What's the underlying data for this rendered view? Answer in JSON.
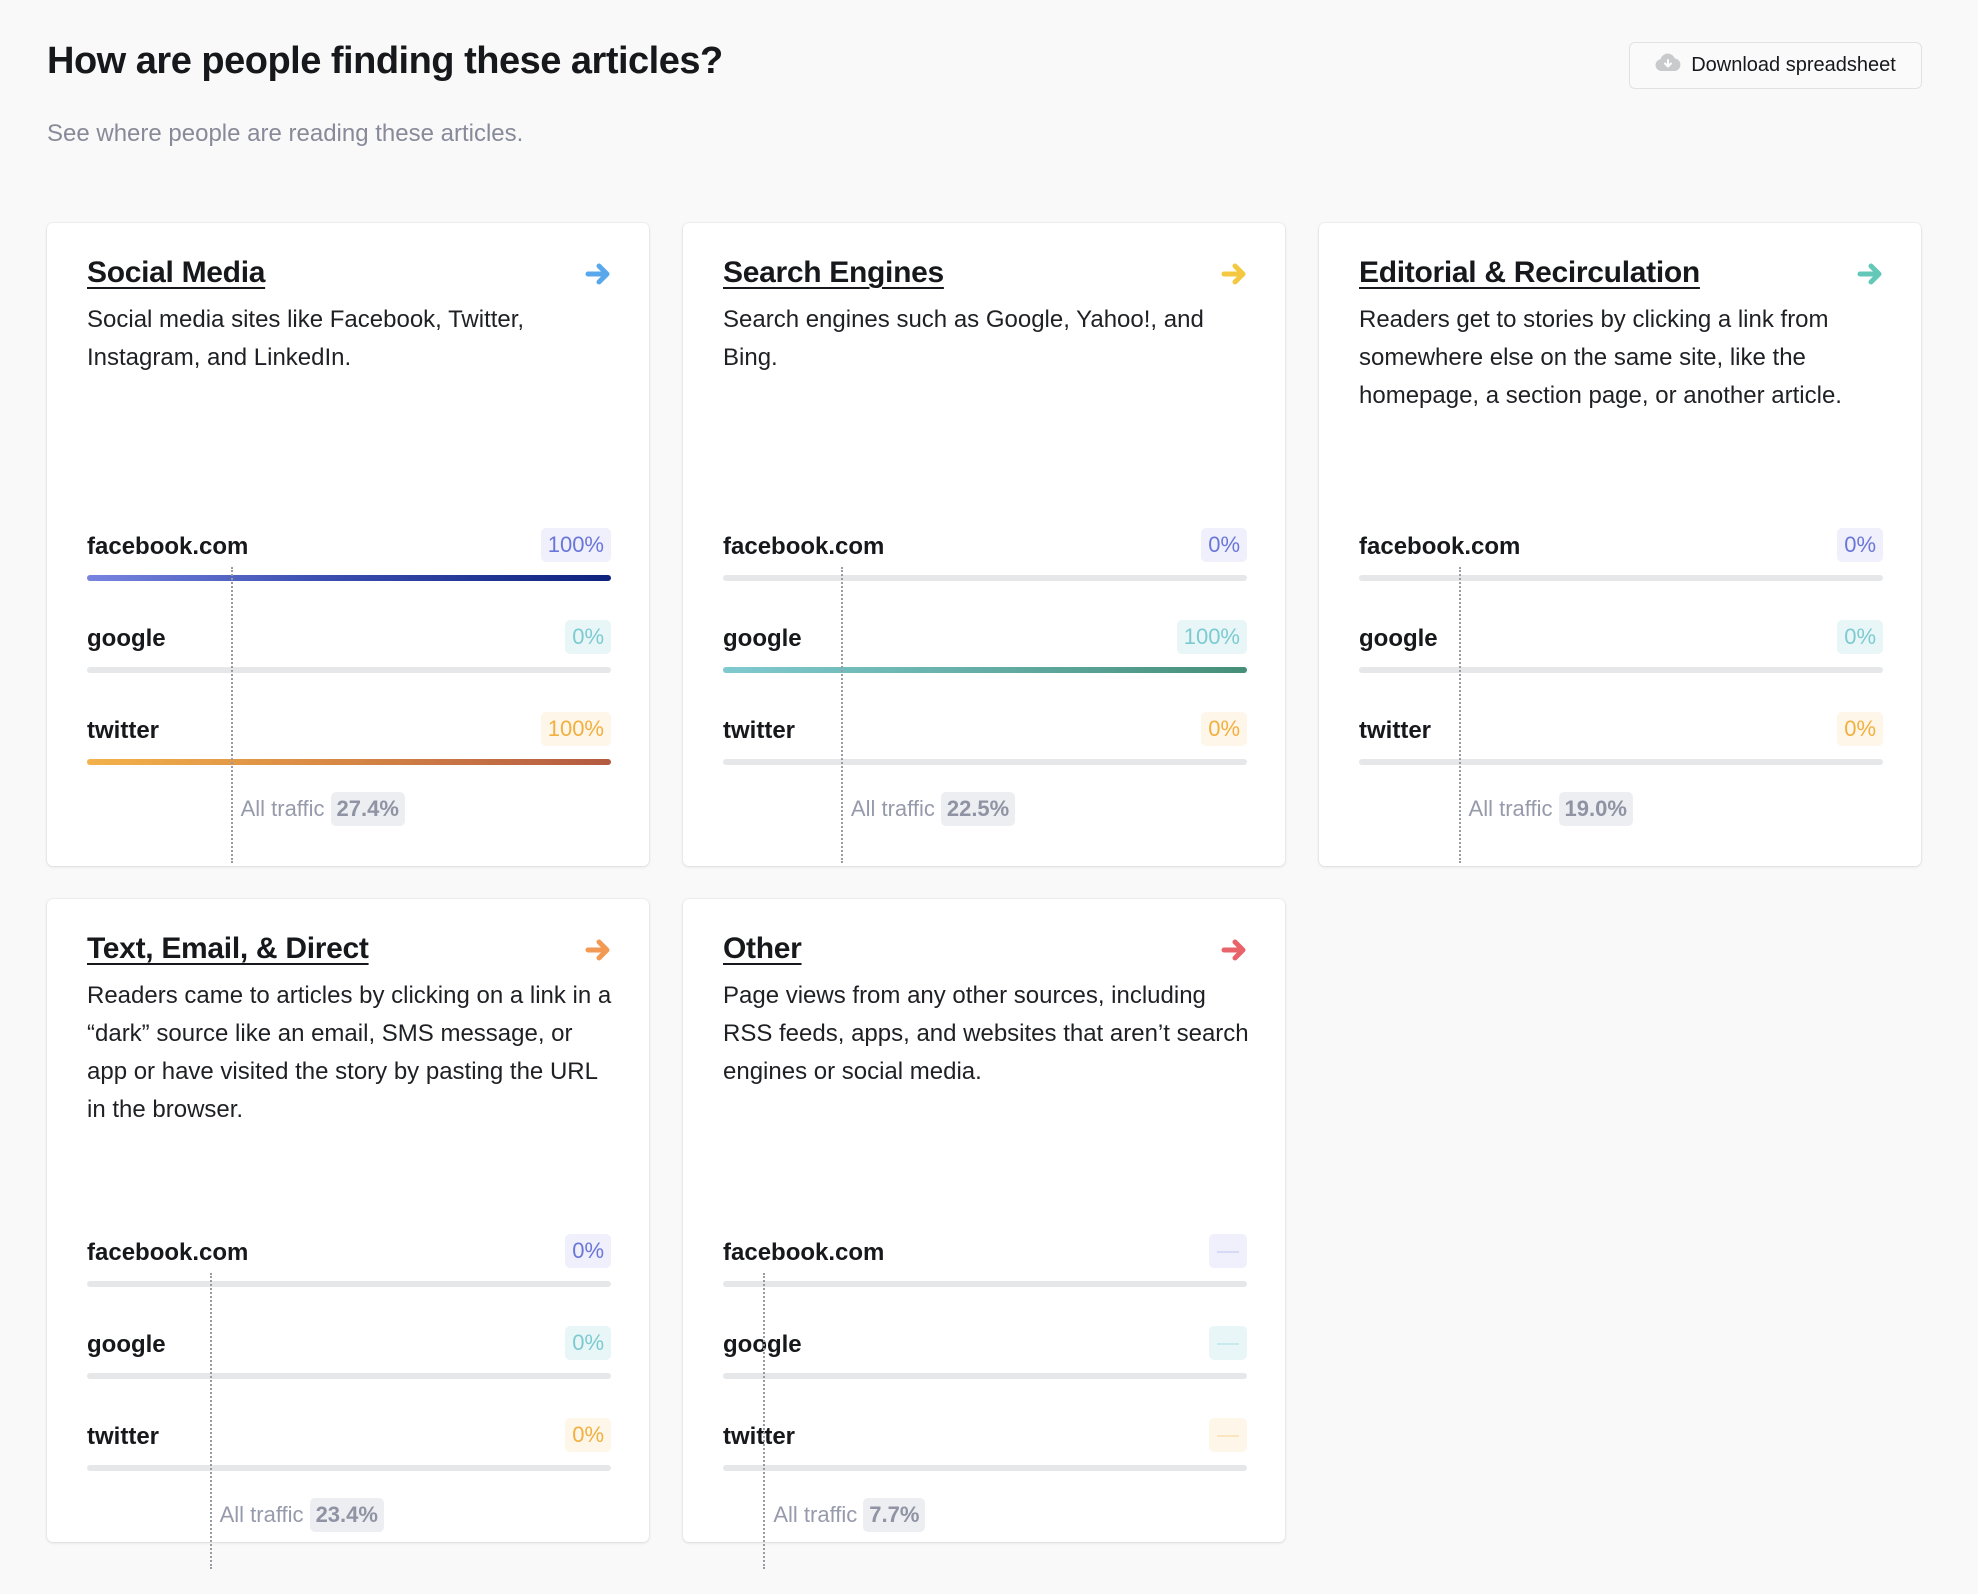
{
  "header": {
    "title": "How are people finding these articles?",
    "subtitle": "See where people are reading these articles.",
    "download_label": "Download spreadsheet",
    "download_icon": "cloud-download-icon"
  },
  "colors": {
    "facebook": "#6a76d9",
    "google": "#7ccbd1",
    "twitter": "#f1b03f"
  },
  "cards": [
    {
      "title": "Social Media",
      "arrow_color": "#5aa8ec",
      "description": "Social media sites like Facebook, Twitter, Instagram, and LinkedIn.",
      "rows": [
        {
          "label": "facebook.com",
          "value": "100%",
          "fraction": 1.0
        },
        {
          "label": "google",
          "value": "0%",
          "fraction": 0
        },
        {
          "label": "twitter",
          "value": "100%",
          "fraction": 1.0
        }
      ],
      "all_traffic_label": "All traffic",
      "all_traffic": "27.4%",
      "all_traffic_fraction": 0.274
    },
    {
      "title": "Search Engines",
      "arrow_color": "#f5c842",
      "description": "Search engines such as Google, Yahoo!, and Bing.",
      "rows": [
        {
          "label": "facebook.com",
          "value": "0%",
          "fraction": 0
        },
        {
          "label": "google",
          "value": "100%",
          "fraction": 1.0
        },
        {
          "label": "twitter",
          "value": "0%",
          "fraction": 0
        }
      ],
      "all_traffic_label": "All traffic",
      "all_traffic": "22.5%",
      "all_traffic_fraction": 0.225
    },
    {
      "title": "Editorial & Recirculation",
      "arrow_color": "#63c8b8",
      "description": "Readers get to stories by clicking a link from somewhere else on the same site, like the homepage, a section page, or another article.",
      "rows": [
        {
          "label": "facebook.com",
          "value": "0%",
          "fraction": 0
        },
        {
          "label": "google",
          "value": "0%",
          "fraction": 0
        },
        {
          "label": "twitter",
          "value": "0%",
          "fraction": 0
        }
      ],
      "all_traffic_label": "All traffic",
      "all_traffic": "19.0%",
      "all_traffic_fraction": 0.19
    },
    {
      "title": "Text, Email, & Direct",
      "arrow_color": "#f29a54",
      "description": "Readers came to articles by clicking on a link in a “dark” source like an email, SMS message, or app or have visited the story by pasting the URL in the browser.",
      "rows": [
        {
          "label": "facebook.com",
          "value": "0%",
          "fraction": 0
        },
        {
          "label": "google",
          "value": "0%",
          "fraction": 0
        },
        {
          "label": "twitter",
          "value": "0%",
          "fraction": 0
        }
      ],
      "all_traffic_label": "All traffic",
      "all_traffic": "23.4%",
      "all_traffic_fraction": 0.234
    },
    {
      "title": "Other",
      "arrow_color": "#e8636a",
      "description": "Page views from any other sources, including RSS feeds, apps, and websites that aren’t search engines or social media.",
      "rows": [
        {
          "label": "facebook.com",
          "value": null,
          "fraction": 0
        },
        {
          "label": "google",
          "value": null,
          "fraction": 0
        },
        {
          "label": "twitter",
          "value": null,
          "fraction": 0
        }
      ],
      "all_traffic_label": "All traffic",
      "all_traffic": "7.7%",
      "all_traffic_fraction": 0.077
    }
  ]
}
